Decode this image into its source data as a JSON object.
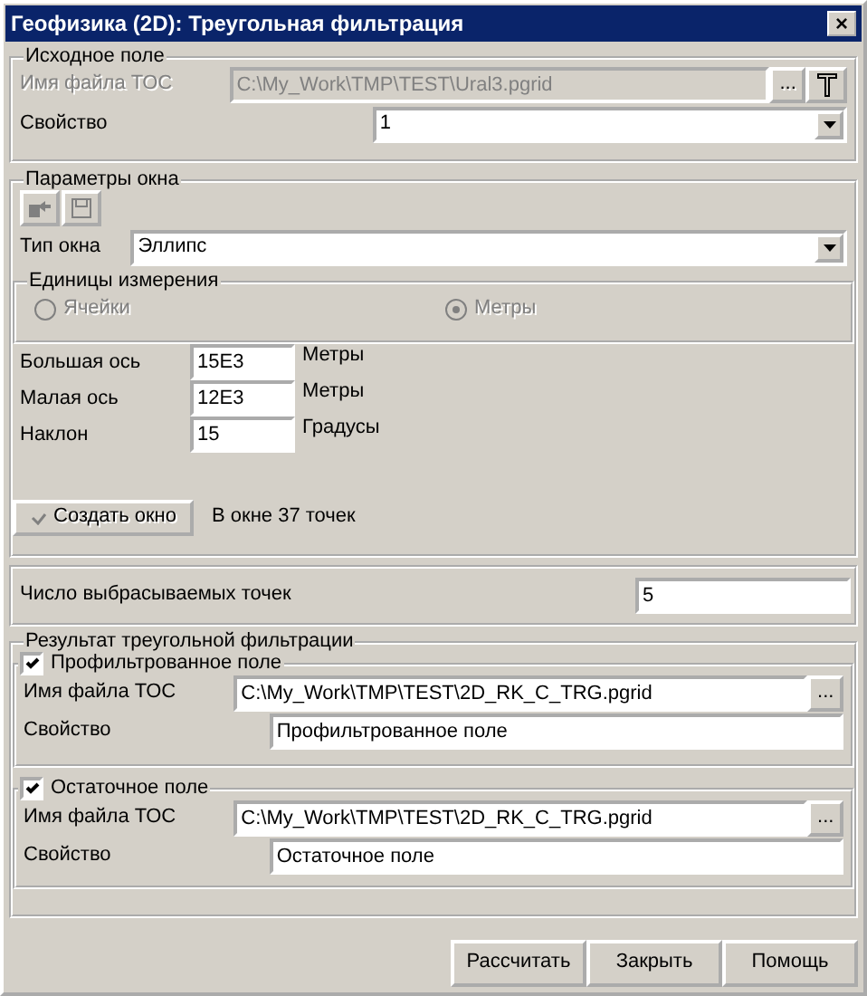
{
  "window": {
    "title": "Геофизика (2D): Треугольная фильтрация",
    "close": "×"
  },
  "source": {
    "legend": "Исходное поле",
    "disabled": true,
    "file_label": "Имя файла ТОС",
    "file_value": "C:\\My_Work\\TMP\\TEST\\Ural3.pgrid",
    "browse": "...",
    "property_label": "Свойство",
    "property_value": "1"
  },
  "window_params": {
    "legend": "Параметры окна",
    "type_label": "Тип окна",
    "type_value": "Эллипс",
    "units": {
      "legend": "Единицы измерения",
      "disabled": true,
      "options": [
        {
          "label": "Ячейки",
          "selected": false
        },
        {
          "label": "Метры",
          "selected": true
        }
      ]
    },
    "axes": [
      {
        "label": "Большая ось",
        "value": "15E3",
        "unit": "Метры"
      },
      {
        "label": "Малая ось",
        "value": "12E3",
        "unit": "Метры"
      },
      {
        "label": "Наклон",
        "value": "15",
        "unit": "Градусы"
      }
    ],
    "create_button": {
      "label": "Создать окно",
      "disabled": true
    },
    "points_info": "В окне 37 точек"
  },
  "discard": {
    "label": "Число выбрасываемых точек",
    "value": "5"
  },
  "result": {
    "legend": "Результат треугольной фильтрации",
    "outputs": [
      {
        "label": "Профильтрованное поле",
        "checked": true,
        "file_label": "Имя файла ТОС",
        "file_value": "C:\\My_Work\\TMP\\TEST\\2D_RK_C_TRG.pgrid",
        "browse": "...",
        "property_label": "Свойство",
        "property_value": "Профильтрованное поле"
      },
      {
        "label": "Остаточное поле",
        "checked": true,
        "file_label": "Имя файла ТОС",
        "file_value": "C:\\My_Work\\TMP\\TEST\\2D_RK_C_TRG.pgrid",
        "browse": "...",
        "property_label": "Свойство",
        "property_value": "Остаточное поле"
      }
    ]
  },
  "buttons": [
    "Рассчитать",
    "Закрыть",
    "Помощь"
  ]
}
